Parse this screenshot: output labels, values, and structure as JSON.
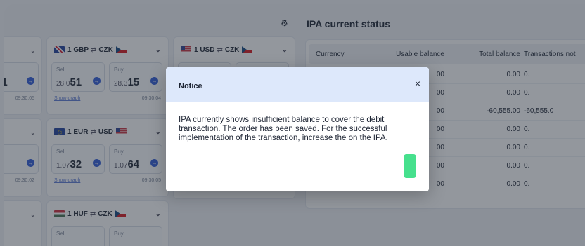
{
  "colors": {
    "accent": "#2e5bd8",
    "confirm_button": "#46e08d",
    "modal_header": "#dde8fb",
    "overlay": "#28303c"
  },
  "fx_cards": [
    {
      "pair_from": "1 GBP",
      "pair_to": "CZK",
      "from_flag": "gb-flag-icon",
      "to_flag": "cz-flag-icon",
      "sell_label": "Sell",
      "sell_prefix": "28.0",
      "sell_main": "51",
      "buy_label": "Buy",
      "buy_prefix": "28.3",
      "buy_main": "15",
      "graph_link": "Show graph",
      "time": "09:30:04"
    },
    {
      "pair_from": "1 USD",
      "pair_to": "CZK",
      "from_flag": "us-flag-icon",
      "to_flag": "cz-flag-icon"
    },
    {
      "pair_from": "1 EUR",
      "pair_to": "USD",
      "from_flag": "eu-flag-icon",
      "to_flag": "us-flag-icon",
      "sell_label": "Sell",
      "sell_prefix": "1.07",
      "sell_main": "32",
      "buy_label": "Buy",
      "buy_prefix": "1.07",
      "buy_main": "64",
      "graph_link": "Show graph",
      "time": "09:30:05"
    },
    {
      "pair_from": "1 HUF",
      "pair_to": "CZK",
      "from_flag": "hu-flag-icon",
      "to_flag": "cz-flag-icon",
      "sell_label": "Sell",
      "buy_label": "Buy"
    }
  ],
  "left_partial": {
    "row1_value": "51",
    "row1_time": "09:30:05",
    "row2_value": "5",
    "row2_time": "09:30:02"
  },
  "status": {
    "title": "IPA current status",
    "columns": [
      "Currency",
      "Usable balance",
      "Total balance",
      "Transactions not"
    ],
    "rows": [
      {
        "usable": "00",
        "total": "0.00",
        "trans": "0."
      },
      {
        "usable": "00",
        "total": "0.00",
        "trans": "0."
      },
      {
        "usable": "00",
        "total": "-60,555.00",
        "trans": "-60,555.0"
      },
      {
        "usable": "00",
        "total": "0.00",
        "trans": "0."
      },
      {
        "usable": "00",
        "total": "0.00",
        "trans": "0."
      },
      {
        "usable": "00",
        "total": "0.00",
        "trans": "0."
      },
      {
        "usable": "00",
        "total": "0.00",
        "trans": "0."
      }
    ]
  },
  "modal": {
    "title": "Notice",
    "close_label": "×",
    "message": "IPA currently shows insufficient balance to cover the debit transaction. The order has been saved. For the successful implementation of the transaction, increase the on the IPA.",
    "button_label": ""
  }
}
